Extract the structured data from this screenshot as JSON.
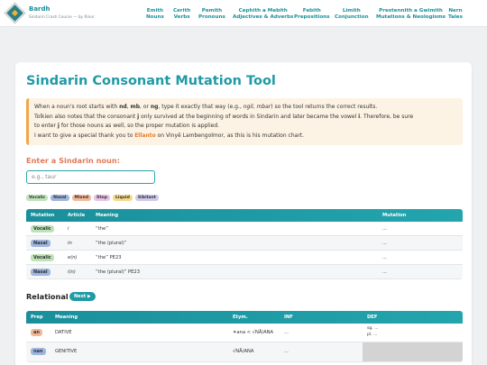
{
  "header": {
    "brand_title": "Bardh",
    "brand_subtitle": "Sindarin Crash Course — by Rínor",
    "nav": [
      {
        "line1": "Emith",
        "line2": "Nouns"
      },
      {
        "line1": "Cerith",
        "line2": "Verbs"
      },
      {
        "line1": "Pemith",
        "line2": "Pronouns"
      },
      {
        "line1": "Cephith a Mebith",
        "line2": "Adjectives & Adverbs"
      },
      {
        "line1": "Febith",
        "line2": "Prepositions"
      },
      {
        "line1": "Limith",
        "line2": "Conjunction"
      },
      {
        "line1": "Prestennith a Gwimith",
        "line2": "Mutations & Neologisms"
      },
      {
        "line1": "Nern",
        "line2": "Tales"
      }
    ]
  },
  "main": {
    "title": "Sindarin Consonant Mutation Tool",
    "info": {
      "line1_a": "When a noun's root starts with ",
      "line1_nd": "nd",
      "line1_b": ", ",
      "line1_mb": "mb",
      "line1_c": ", or ",
      "line1_ng": "ng",
      "line1_d": ", type it exactly that way (e.g., ",
      "line1_ngil": "ngil, mbar",
      "line1_e": ") so the tool returns the correct results.",
      "line2_a": "Tolkien also notes that the consonant ",
      "line2_j": "j",
      "line2_b": " only survived at the beginning of words in Sindarin and later became the vowel ",
      "line2_i": "i",
      "line2_c": ". Therefore, be sure",
      "line3_a": "to enter ",
      "line3_j": "j",
      "line3_b": " for those nouns as well, so the proper mutation is applied.",
      "line4_a": "I want to give a special thank you to ",
      "line4_link": "Ellanto",
      "line4_b": " on Vinyë Lambengolmor, as this is his mutation chart."
    },
    "enter_label": "Enter a Sindarin noun:",
    "input_placeholder": "e.g., taur",
    "legend": [
      {
        "label": "Vocalic",
        "color": "#bfe3b8"
      },
      {
        "label": "Nasal",
        "color": "#9fb6e0"
      },
      {
        "label": "Mixed",
        "color": "#f3b89a"
      },
      {
        "label": "Stop",
        "color": "#e8c1e6"
      },
      {
        "label": "Liquid",
        "color": "#f5d98a"
      },
      {
        "label": "Sibilant",
        "color": "#cfc9ec"
      }
    ],
    "article_table": {
      "headers": [
        "Mutation",
        "Article",
        "Meaning",
        "Mutation"
      ],
      "rows": [
        {
          "mutation": "Vocalic",
          "mut_color": "#bfe3b8",
          "article": "i",
          "meaning": "“the”",
          "result": "..."
        },
        {
          "mutation": "Nasal",
          "mut_color": "#9fb6e0",
          "article": "in",
          "meaning": "“the (plural)”",
          "result": "..."
        },
        {
          "mutation": "Vocalic",
          "mut_color": "#bfe3b8",
          "article": "e(n)",
          "meaning": "“the” PE23",
          "result": "..."
        },
        {
          "mutation": "Nasal",
          "mut_color": "#9fb6e0",
          "article": "i(n)",
          "meaning": "“the (plural)” PE23",
          "result": "..."
        }
      ]
    },
    "relational_label": "Relational",
    "next_button": "Next ▶",
    "prep_table": {
      "headers": [
        "Prep",
        "Meaning",
        "Etym.",
        "INF",
        "DEF"
      ],
      "rows": [
        {
          "prep": "an",
          "prep_color": "#f3b89a",
          "meaning": "DATIVE",
          "etym": "✦ana < √NĀ/ANA",
          "inf": "...",
          "def1": "sg. ...",
          "def2": "pl. ..."
        },
        {
          "prep": "nan",
          "prep_color": "#9fb6e0",
          "meaning": "GENITIVE",
          "etym": "√NĀ/ANA",
          "inf": "...",
          "def1": "",
          "def2": ""
        }
      ]
    }
  }
}
